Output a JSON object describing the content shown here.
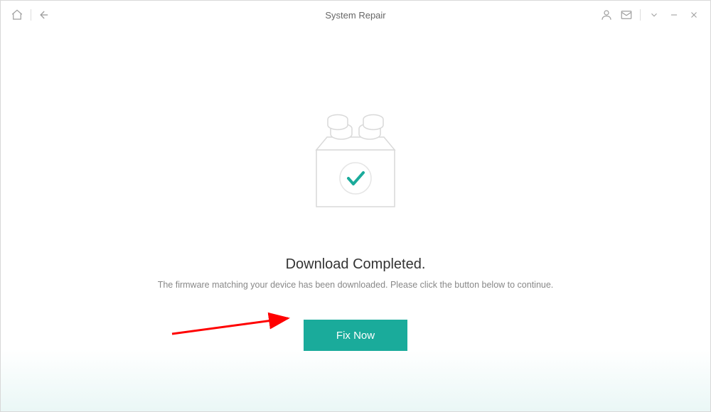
{
  "titlebar": {
    "title": "System Repair"
  },
  "content": {
    "heading": "Download Completed.",
    "subtext": "The firmware matching your device has been downloaded. Please click the button below to continue.",
    "button": "Fix Now"
  },
  "colors": {
    "accent": "#1aab9b",
    "arrow": "#ff0000"
  }
}
